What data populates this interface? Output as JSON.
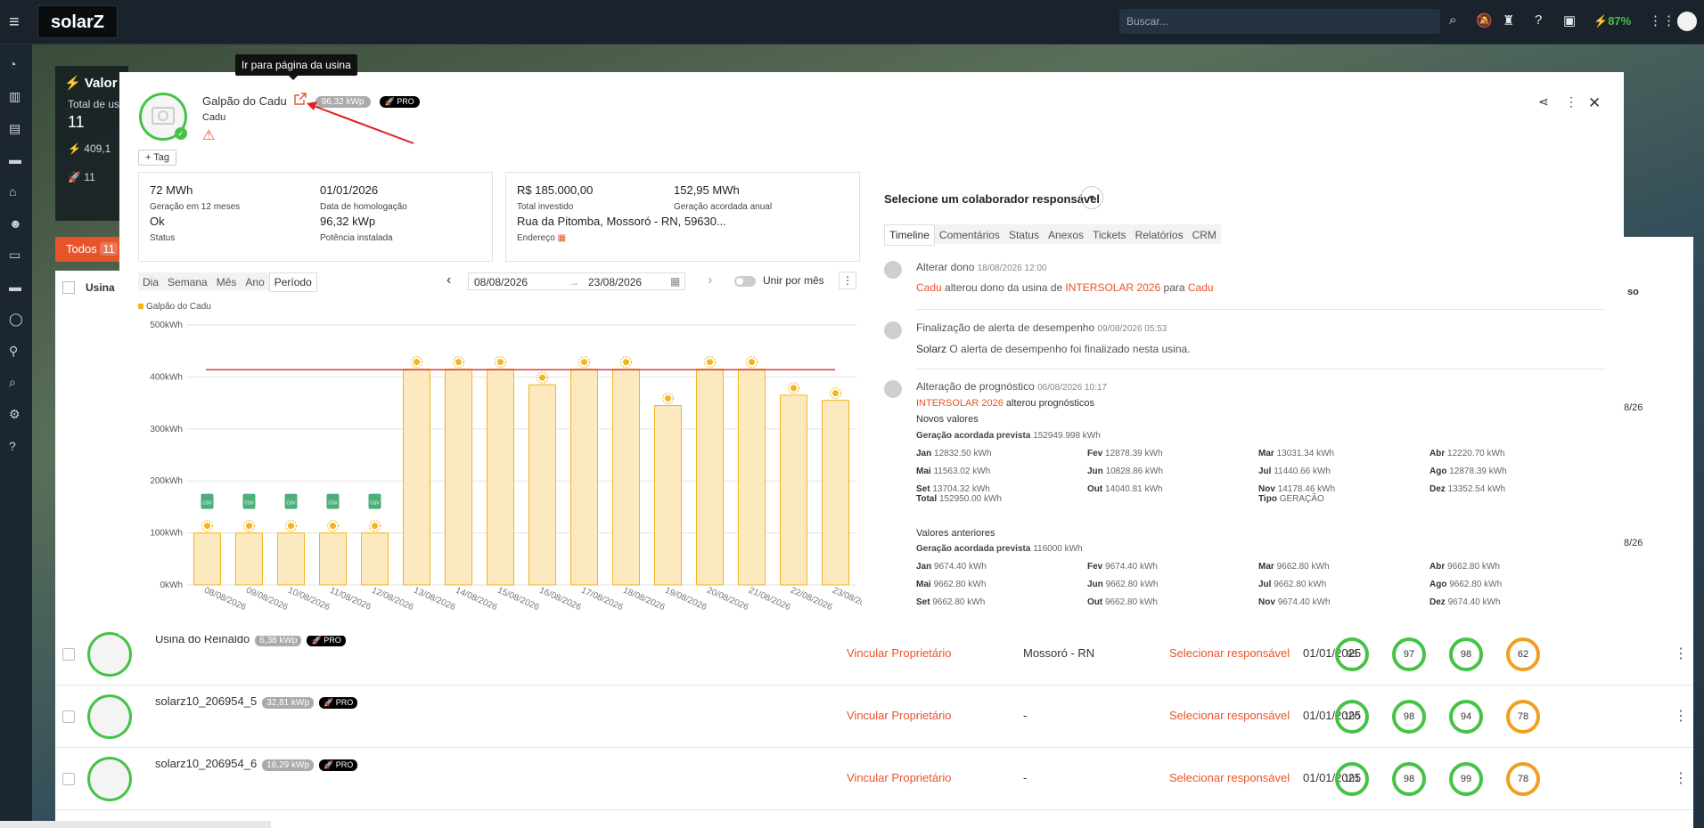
{
  "topbar": {
    "logo": "solarZ",
    "search_placeholder": "Buscar...",
    "battery": "87%"
  },
  "background_rows": [
    {
      "name": "Usina do Reinaldo",
      "kwp": "6,38 kWp",
      "pro": "PRO",
      "vincular": "Vincular Proprietário",
      "city": "Mossoró - RN",
      "responsavel": "Selecionar responsável",
      "date": "01/01/2025",
      "scores": [
        "95",
        "97",
        "98",
        "62"
      ]
    },
    {
      "name": "solarz10_206954_5",
      "kwp": "32,81 kWp",
      "pro": "PRO",
      "vincular": "Vincular Proprietário",
      "city": "-",
      "responsavel": "Selecionar responsável",
      "date": "01/01/2025",
      "scores": [
        "100",
        "98",
        "94",
        "78"
      ]
    },
    {
      "name": "solarz10_206954_6",
      "kwp": "18,29 kWp",
      "pro": "PRO",
      "vincular": "Vincular Proprietário",
      "city": "-",
      "responsavel": "Selecionar responsável",
      "date": "01/01/2025",
      "scores": [
        "101",
        "98",
        "99",
        "78"
      ]
    }
  ],
  "background_cards": {
    "valor_title": "Valor",
    "total_label": "Total de us",
    "total_value": "11",
    "gen_value": "409,1",
    "count_value": "11",
    "todos_tab": "Todos",
    "todos_count": "11",
    "usina_header": "Usina",
    "side_date_1": "8/26",
    "side_date_2": "8/26",
    "side_header": "so"
  },
  "tooltip": "Ir para página da usina",
  "plant": {
    "name": "Galpão do Cadu",
    "kwp": "96,32 kWp",
    "pro": "PRO",
    "owner": "Cadu",
    "tag_button": "+ Tag"
  },
  "info_left": {
    "gen12_value": "72 MWh",
    "gen12_label": "Geração em 12 meses",
    "homolog_value": "01/01/2026",
    "homolog_label": "Data de homologação",
    "status_value": "Ok",
    "status_label": "Status",
    "power_value": "96,32 kWp",
    "power_label": "Potência instalada"
  },
  "info_right": {
    "invest_value": "R$ 185.000,00",
    "invest_label": "Total investido",
    "agreed_value": "152,95 MWh",
    "agreed_label": "Geração acordada anual",
    "address_value": "Rua da Pitomba, Mossoró - RN, 59630...",
    "address_label": "Endereço"
  },
  "period": {
    "tabs": [
      "Dia",
      "Semana",
      "Mês",
      "Ano",
      "Período"
    ],
    "active": "Período",
    "start": "08/08/2026",
    "end": "23/08/2026",
    "toggle_label": "Unir por mês"
  },
  "chart_data": {
    "type": "bar",
    "series": [
      {
        "name": "Galpão do Cadu",
        "values": [
          100,
          100,
          100,
          100,
          100,
          415,
          415,
          415,
          385,
          415,
          415,
          345,
          415,
          415,
          365,
          355
        ]
      }
    ],
    "categories": [
      "08/08/2026",
      "09/08/2026",
      "10/08/2026",
      "11/08/2026",
      "12/08/2026",
      "13/08/2026",
      "14/08/2026",
      "15/08/2026",
      "16/08/2026",
      "17/08/2026",
      "18/08/2026",
      "19/08/2026",
      "20/08/2026",
      "21/08/2026",
      "22/08/2026",
      "23/08/2026"
    ],
    "y_ticks": [
      "0kWh",
      "100kWh",
      "200kWh",
      "300kWh",
      "400kWh",
      "500kWh"
    ],
    "ylim": [
      0,
      500
    ],
    "reference_line": 414,
    "estimated_days": 5,
    "grid": true,
    "legend": "top-left",
    "colors": {
      "bar": "#fde9c0",
      "bar_border": "#f3b520",
      "line": "#e03a3a",
      "icon": "#f3b520",
      "csv": "#4caf7a"
    }
  },
  "right": {
    "select_responsible": "Selecione um colaborador responsável",
    "tabs": [
      "Timeline",
      "Comentários",
      "Status",
      "Anexos",
      "Tickets",
      "Relatórios",
      "CRM"
    ],
    "active_tab": "Timeline"
  },
  "timeline": {
    "e1": {
      "title": "Alterar dono",
      "time": "18/08/2026 12:00",
      "actor": "Cadu",
      "mid": " alterou dono da usina de ",
      "from": "INTERSOLAR 2026",
      "para": " para ",
      "to": "Cadu"
    },
    "e2": {
      "title": "Finalização de alerta de desempenho",
      "time": "09/08/2026 05:53",
      "actor": "Solarz",
      "rest": " O alerta de desempenho foi finalizado nesta usina."
    },
    "e3": {
      "title": "Alteração de prognóstico",
      "time": "06/08/2026 10:17",
      "actor": "INTERSOLAR 2026",
      "rest": " alterou prognósticos",
      "new_title": "Novos valores",
      "new_agreed_label": "Geração acordada prevista",
      "new_agreed_value": "152949.998 kWh",
      "new_values": [
        [
          "Jan",
          "12832.50 kWh"
        ],
        [
          "Fev",
          "12878.39 kWh"
        ],
        [
          "Mar",
          "13031.34 kWh"
        ],
        [
          "Abr",
          "12220.70 kWh"
        ],
        [
          "Mai",
          "11563.02 kWh"
        ],
        [
          "Jun",
          "10828.86 kWh"
        ],
        [
          "Jul",
          "11440.66 kWh"
        ],
        [
          "Ago",
          "12878.39 kWh"
        ],
        [
          "Set",
          "13704.32 kWh"
        ],
        [
          "Out",
          "14040.81 kWh"
        ],
        [
          "Nov",
          "14178.46 kWh"
        ],
        [
          "Dez",
          "13352.54 kWh"
        ]
      ],
      "new_total_label": "Total",
      "new_total_value": "152950.00 kWh",
      "new_type_label": "Tipo",
      "new_type_value": "GERAÇÃO",
      "old_title": "Valores anteriores",
      "old_agreed_label": "Geração acordada prevista",
      "old_agreed_value": "116000 kWh",
      "old_values": [
        [
          "Jan",
          "9674.40 kWh"
        ],
        [
          "Fev",
          "9674.40 kWh"
        ],
        [
          "Mar",
          "9662.80 kWh"
        ],
        [
          "Abr",
          "9662.80 kWh"
        ],
        [
          "Mai",
          "9662.80 kWh"
        ],
        [
          "Jun",
          "9662.80 kWh"
        ],
        [
          "Jul",
          "9662.80 kWh"
        ],
        [
          "Ago",
          "9662.80 kWh"
        ],
        [
          "Set",
          "9662.80 kWh"
        ],
        [
          "Out",
          "9662.80 kWh"
        ],
        [
          "Nov",
          "9674.40 kWh"
        ],
        [
          "Dez",
          "9674.40 kWh"
        ]
      ]
    }
  }
}
